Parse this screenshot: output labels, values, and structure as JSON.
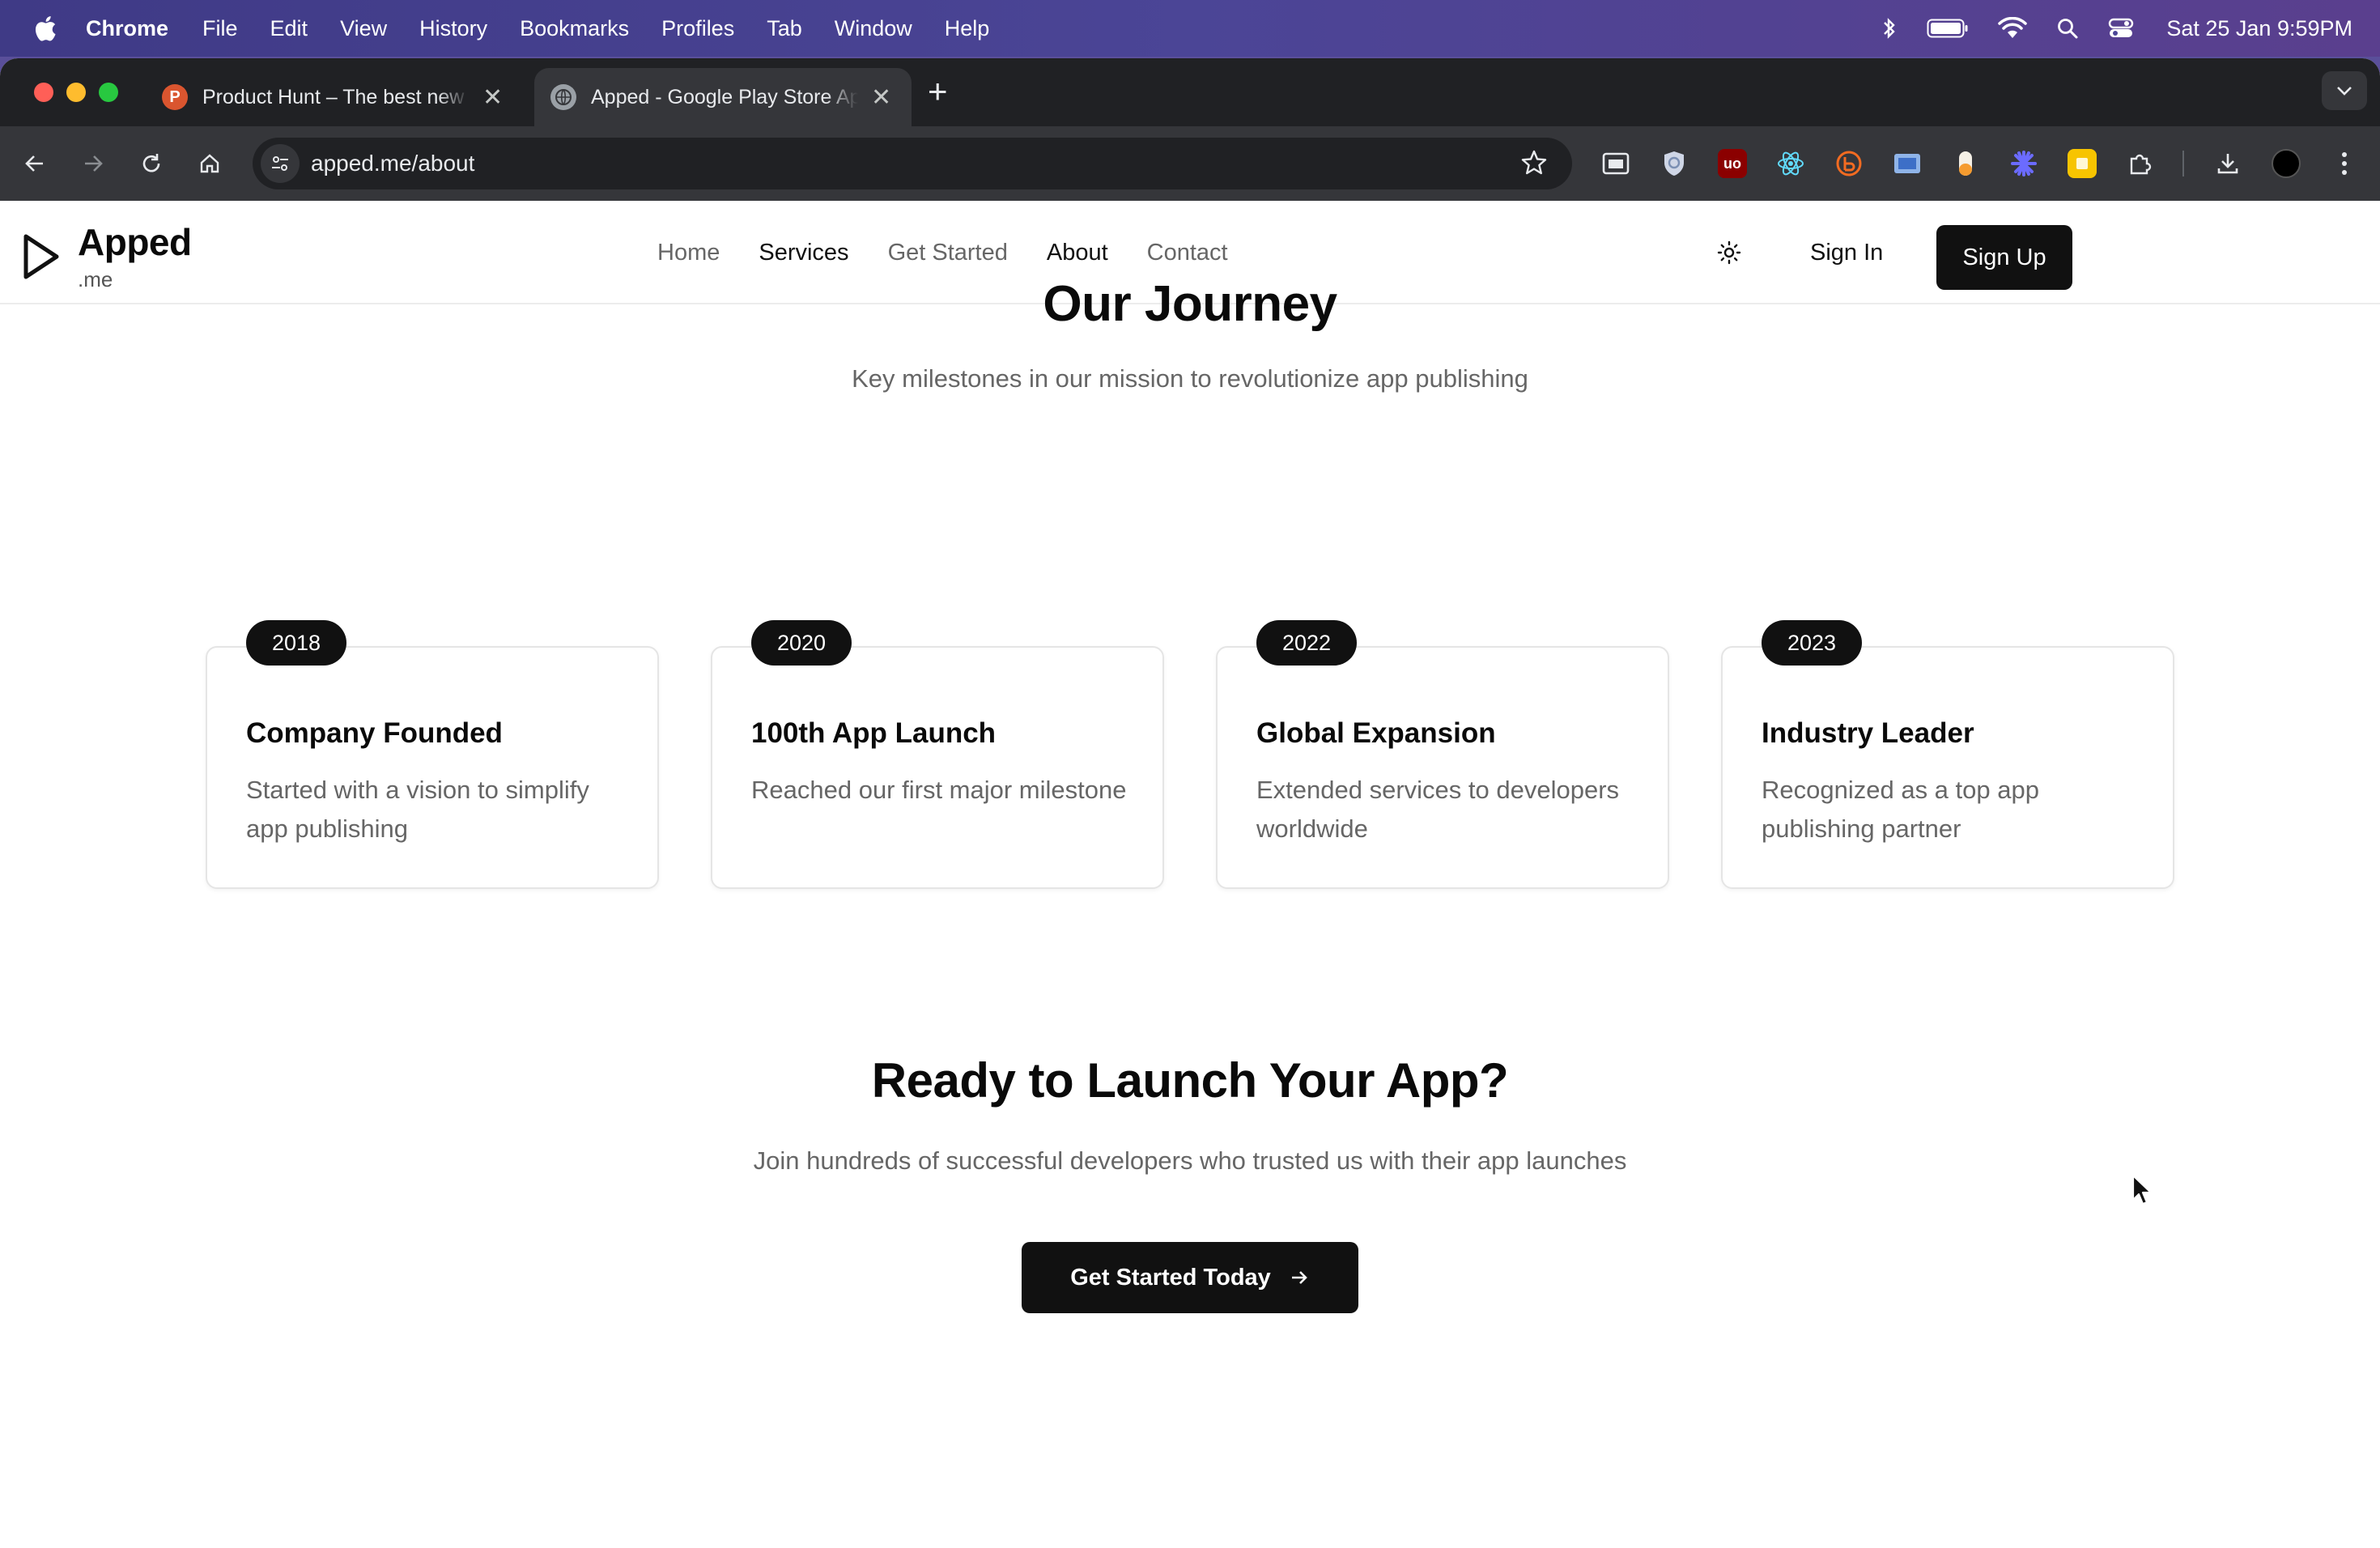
{
  "menubar": {
    "app": "Chrome",
    "items": [
      "File",
      "Edit",
      "View",
      "History",
      "Bookmarks",
      "Profiles",
      "Tab",
      "Window",
      "Help"
    ],
    "clock": "Sat 25 Jan  9:59PM"
  },
  "browser": {
    "tabs": [
      {
        "title": "Product Hunt – The best new products in tech.",
        "favicon_letter": "P",
        "favicon_color": "#da552f"
      },
      {
        "title": "Apped - Google Play Store App Publishing",
        "favicon_color": "#9aa0a6"
      }
    ],
    "url": "apped.me/about"
  },
  "site": {
    "logo": {
      "name": "Apped",
      "tld": ".me"
    },
    "nav": [
      "Home",
      "Services",
      "Get Started",
      "About",
      "Contact"
    ],
    "sign_in": "Sign In",
    "sign_up": "Sign Up"
  },
  "journey": {
    "title": "Our Journey",
    "subtitle": "Key milestones in our mission to revolutionize app publishing",
    "milestones": [
      {
        "year": "2018",
        "title": "Company Founded",
        "description": "Started with a vision to simplify app publishing"
      },
      {
        "year": "2020",
        "title": "100th App Launch",
        "description": "Reached our first major milestone"
      },
      {
        "year": "2022",
        "title": "Global Expansion",
        "description": "Extended services to developers worldwide"
      },
      {
        "year": "2023",
        "title": "Industry Leader",
        "description": "Recognized as a top app publishing partner"
      }
    ]
  },
  "cta": {
    "title": "Ready to Launch Your App?",
    "subtitle": "Join hundreds of successful developers who trusted us with their app launches",
    "button": "Get Started Today"
  },
  "colors": {
    "accent": "#111111",
    "muted_text": "#666666",
    "card_border": "#e5e5e5"
  }
}
